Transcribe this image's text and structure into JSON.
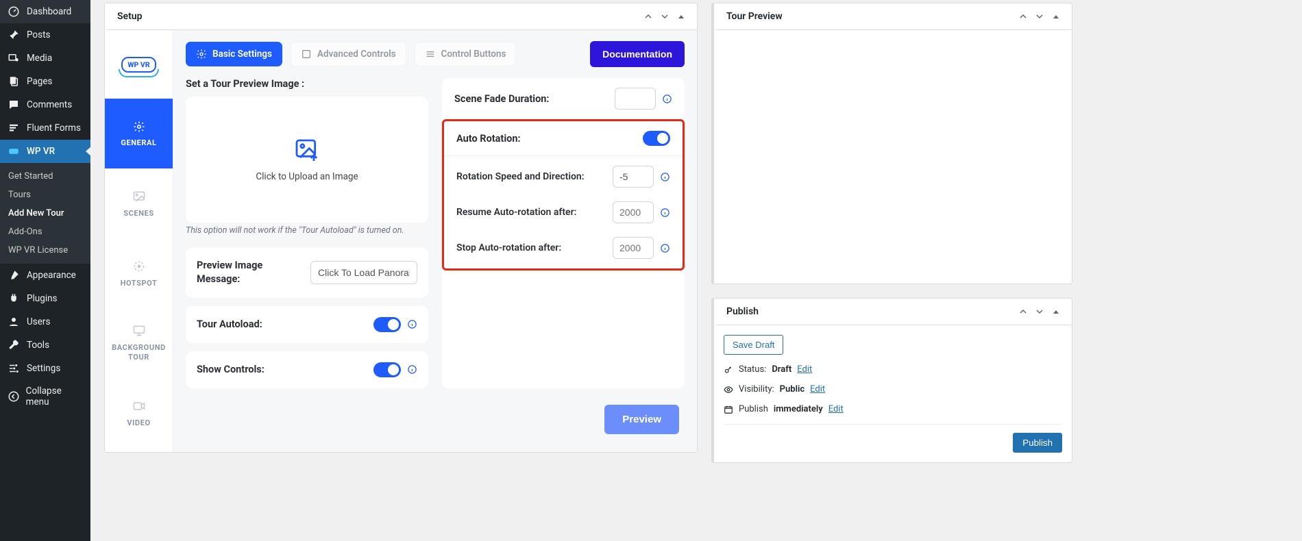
{
  "sidebar": {
    "items": [
      {
        "icon": "dashboard",
        "label": "Dashboard"
      },
      {
        "icon": "pin",
        "label": "Posts"
      },
      {
        "icon": "media",
        "label": "Media"
      },
      {
        "icon": "pages",
        "label": "Pages"
      },
      {
        "icon": "comment",
        "label": "Comments"
      },
      {
        "icon": "forms",
        "label": "Fluent Forms"
      },
      {
        "icon": "vr",
        "label": "WP VR"
      }
    ],
    "submenu": [
      {
        "label": "Get Started"
      },
      {
        "label": "Tours"
      },
      {
        "label": "Add New Tour"
      },
      {
        "label": "Add-Ons"
      },
      {
        "label": "WP VR License"
      }
    ],
    "items2": [
      {
        "icon": "brush",
        "label": "Appearance"
      },
      {
        "icon": "plug",
        "label": "Plugins"
      },
      {
        "icon": "user",
        "label": "Users"
      },
      {
        "icon": "wrench",
        "label": "Tools"
      },
      {
        "icon": "sliders",
        "label": "Settings"
      },
      {
        "icon": "collapse",
        "label": "Collapse menu"
      }
    ]
  },
  "panels": {
    "setup_title": "Setup",
    "preview_title": "Tour Preview",
    "publish_title": "Publish"
  },
  "vtabs": {
    "logo": "WP VR",
    "general": "GENERAL",
    "scenes": "SCENES",
    "hotspot": "HOTSPOT",
    "bgtour": "BACKGROUND TOUR",
    "video": "VIDEO"
  },
  "toptabs": {
    "basic": "Basic Settings",
    "advanced": "Advanced Controls",
    "control": "Control Buttons",
    "doc": "Documentation"
  },
  "left": {
    "set_preview_label": "Set a Tour Preview Image :",
    "upload_text": "Click to Upload an Image",
    "hint": "This option will not work if the \"Tour Autoload\" is turned on.",
    "preview_msg_label": "Preview Image Message:",
    "preview_msg_input": "Click To Load Panoram",
    "autoload_label": "Tour Autoload:",
    "controls_label": "Show Controls:"
  },
  "right": {
    "fade_label": "Scene Fade Duration:",
    "rotation_label": "Auto Rotation:",
    "speed_label": "Rotation Speed and Direction:",
    "speed_value": "-5",
    "resume_label": "Resume Auto-rotation after:",
    "resume_placeholder": "2000",
    "stop_label": "Stop Auto-rotation after:",
    "stop_placeholder": "2000"
  },
  "preview_btn": "Preview",
  "publish": {
    "save_draft": "Save Draft",
    "status_k": "Status:",
    "status_v": "Draft",
    "status_edit": "Edit",
    "vis_k": "Visibility:",
    "vis_v": "Public",
    "vis_edit": "Edit",
    "pub_k": "Publish",
    "pub_v": "immediately",
    "pub_edit": "Edit",
    "publish_btn": "Publish"
  }
}
